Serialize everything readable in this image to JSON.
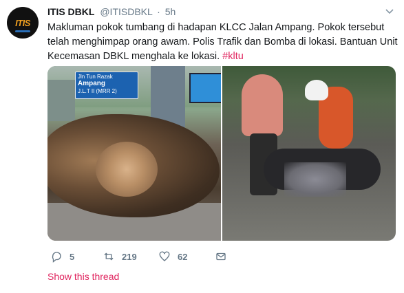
{
  "tweet": {
    "display_name": "ITIS DBKL",
    "handle": "@ITISDBKL",
    "separator": "·",
    "time": "5h",
    "text": "Makluman pokok tumbang di hadapan KLCC Jalan Ampang. Pokok tersebut telah menghimpap orang awam. Polis Trafik dan Bomba di lokasi. Bantuan Unit Kecemasan DBKL menghala ke lokasi.",
    "hashtag": "#kltu",
    "avatar_text": "ITIS",
    "media": {
      "photo1_sign_line1": "Jln Tun Razak",
      "photo1_sign_line2": "Ampang",
      "photo1_sign_line3": "J.L.T II (MRR 2)"
    },
    "actions": {
      "reply_count": "5",
      "retweet_count": "219",
      "like_count": "62"
    },
    "show_thread": "Show this thread"
  },
  "colors": {
    "accent": "#e0245e",
    "muted": "#657786",
    "text": "#14171a"
  },
  "icons": [
    "reply-icon",
    "retweet-icon",
    "like-icon",
    "direct-message-icon",
    "chevron-down-icon"
  ]
}
